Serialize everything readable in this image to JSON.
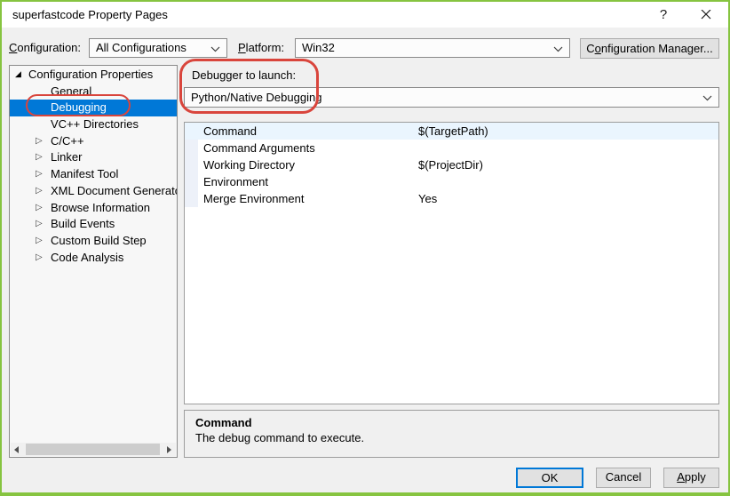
{
  "window": {
    "title": "superfastcode Property Pages"
  },
  "icons": {
    "help": "?",
    "close": "x-cross",
    "combo_chevron": "chevron-down",
    "tree_expanded": "◢",
    "tree_collapsed": "▷",
    "scroll_left": "left-triangle",
    "scroll_right": "right-triangle"
  },
  "toolbar": {
    "configuration_label": {
      "text": "Configuration:",
      "mnemonic": 0
    },
    "configuration_value": "All Configurations",
    "platform_label": {
      "text": "Platform:",
      "mnemonic": 0
    },
    "platform_value": "Win32",
    "configuration_manager": {
      "text": "Configuration Manager...",
      "mnemonic": 1
    }
  },
  "tree": {
    "items": [
      {
        "label": "Configuration Properties",
        "state": "expanded",
        "selected": false
      },
      {
        "label": "General",
        "state": "none",
        "selected": false
      },
      {
        "label": "Debugging",
        "state": "none",
        "selected": true
      },
      {
        "label": "VC++ Directories",
        "state": "none",
        "selected": false
      },
      {
        "label": "C/C++",
        "state": "collapsed",
        "selected": false
      },
      {
        "label": "Linker",
        "state": "collapsed",
        "selected": false
      },
      {
        "label": "Manifest Tool",
        "state": "collapsed",
        "selected": false
      },
      {
        "label": "XML Document Generator",
        "state": "collapsed",
        "selected": false
      },
      {
        "label": "Browse Information",
        "state": "collapsed",
        "selected": false
      },
      {
        "label": "Build Events",
        "state": "collapsed",
        "selected": false
      },
      {
        "label": "Custom Build Step",
        "state": "collapsed",
        "selected": false
      },
      {
        "label": "Code Analysis",
        "state": "collapsed",
        "selected": false
      }
    ]
  },
  "debugger_section": {
    "label": "Debugger to launch:",
    "value": "Python/Native Debugging"
  },
  "property_grid": {
    "rows": [
      {
        "name": "Command",
        "value": "$(TargetPath)",
        "highlighted": true
      },
      {
        "name": "Command Arguments",
        "value": "",
        "highlighted": false
      },
      {
        "name": "Working Directory",
        "value": "$(ProjectDir)",
        "highlighted": false
      },
      {
        "name": "Environment",
        "value": "",
        "highlighted": false
      },
      {
        "name": "Merge Environment",
        "value": "Yes",
        "highlighted": false
      }
    ]
  },
  "description_panel": {
    "title": "Command",
    "text": "The debug command to execute."
  },
  "action_buttons": {
    "ok": "OK",
    "cancel": "Cancel",
    "apply": {
      "text": "Apply",
      "mnemonic": 0
    }
  },
  "annotations": {
    "color": "#d9453c",
    "targets": [
      "Debugging tree item",
      "Debugger to launch dropdown"
    ]
  },
  "colors": {
    "selection_blue": "#0078d7",
    "window_border_green": "#86c440",
    "default_button_border": "#0078d7",
    "titlebar_background": "#ffffff",
    "dialog_background": "#f0f0f0"
  }
}
